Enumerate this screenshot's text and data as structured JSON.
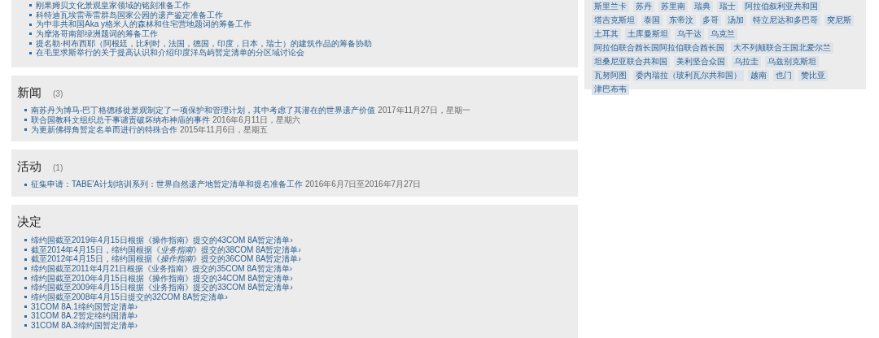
{
  "top_list": [
    "刚果姆贝文化景观皇家领域的铭刻准备工作",
    "科特迪瓦埃雷蒂雷群岛国家公园的遗产鉴定准备工作",
    "为中非共和国Aka y格米人的森林和住宅营地题词的筹备工作",
    "为摩洛哥南部绿洲题词的筹备工作",
    "提名勒·柯布西耶（阿根廷，比利时，法国，德国，印度，日本，瑞士）的建筑作品的筹备协助",
    "在毛里求斯举行的关于提高认识和介绍印度洋岛屿暂定清单的分区域讨论会"
  ],
  "news": {
    "title": "新闻",
    "count": "(3)",
    "items": [
      {
        "title": "南苏丹为博马-巴丁格德移徙景观制定了一项保护和管理计划，其中考虑了其潜在的世界遗产价值",
        "date": "2017年11月27日，星期一"
      },
      {
        "title": "联合国教科文组织总干事谴责破坏纳布神庙的事件",
        "date": "2016年6月11日，星期六"
      },
      {
        "title": "为更新佛得角暂定名单而进行的特殊合作",
        "date": "2015年11月6日，星期五"
      }
    ]
  },
  "events": {
    "title": "活动",
    "count": "(1)",
    "items": [
      {
        "title": "征集申请：TABE'A计划培训系列：世界自然遗产地暂定清单和提名准备工作",
        "date": "2016年6月7日至2016年7月27日"
      }
    ]
  },
  "decisions": {
    "title": "决定",
    "items": [
      "缔约国截至2019年4月15日根据《操作指南》提交的43COM 8A暂定清单›",
      "截至2014年4月15日，缔约国根据《*业务指南*》提交的38COM 8A暂定清单›",
      "截至2012年4月15日，缔约国根据《*操作指南*》提交的36COM 8A暂定清单›",
      "缔约国截至2011年4月21日根据《业务指南》提交的35COM 8A暂定清单›",
      "缔约国截至2010年4月15日根据《操作指南》提交的34COM 8A暂定清单›",
      "缔约国截至2009年4月15日根据《业务指南》提交的33COM 8A暂定清单›",
      "缔约国截至2008年4月15日提交的32COM 8A暂定清单›",
      "31COM 8A.1缔约国暂定清单›",
      "31COM 8A.2暂定缔约国清单›",
      "31COM 8A.3缔约国暂定清单›"
    ]
  },
  "country_tags": [
    "斯里兰卡",
    "苏丹",
    "苏里南",
    "瑞典",
    "瑞士",
    "阿拉伯叙利亚共和国",
    "塔吉克斯坦",
    "泰国",
    "东帝汶",
    "多哥",
    "汤加",
    "特立尼达和多巴哥",
    "突尼斯",
    "土耳其",
    "土库曼斯坦",
    "乌干达",
    "乌克兰",
    "阿拉伯联合酋长国阿拉伯联合酋长国",
    "大不列颠联合王国北爱尔兰",
    "坦桑尼亚联合共和国",
    "美利坚合众国",
    "乌拉圭",
    "乌兹别克斯坦",
    "瓦努阿图",
    "委内瑞拉（玻利瓦尔共和国）",
    "越南",
    "也门",
    "赞比亚",
    "津巴布韦"
  ]
}
